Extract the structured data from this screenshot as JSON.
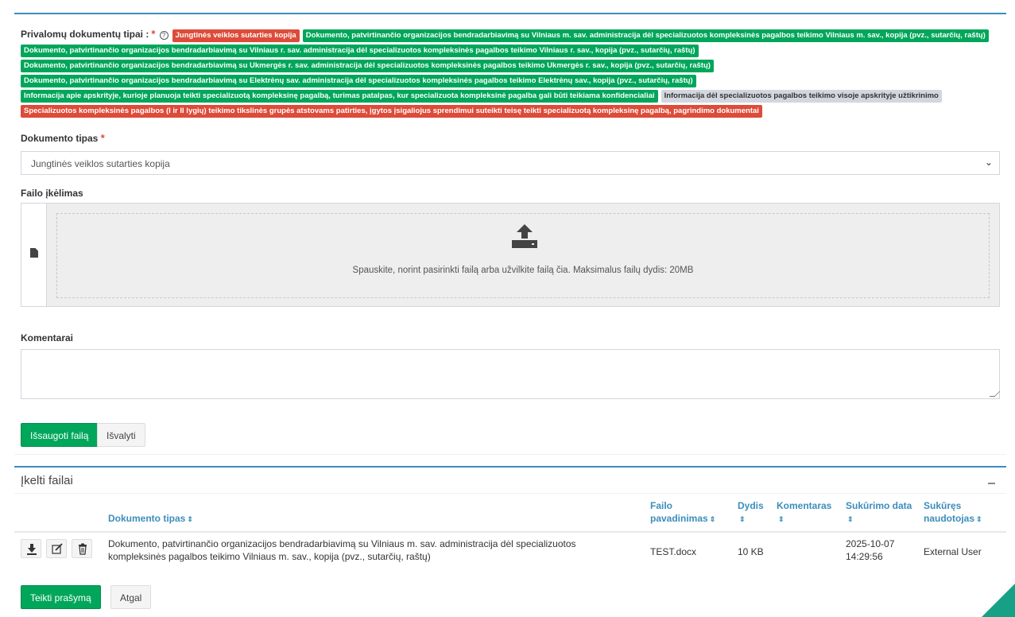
{
  "required": {
    "label": "Privalomų dokumentų tipai :",
    "star": "*",
    "help_icon": "question-circle-icon",
    "badges": [
      {
        "text": "Jungtinės veiklos sutarties kopija",
        "color": "red"
      },
      {
        "text": "Dokumento, patvirtinančio organizacijos bendradarbiavimą su Vilniaus m. sav. administracija dėl specializuotos kompleksinės pagalbos teikimo Vilniaus m. sav., kopija (pvz., sutarčių, raštų)",
        "color": "green"
      },
      {
        "text": "Dokumento, patvirtinančio organizacijos bendradarbiavimą su Vilniaus r. sav. administracija dėl specializuotos kompleksinės pagalbos teikimo Vilniaus r. sav., kopija (pvz., sutarčių, raštų)",
        "color": "green"
      },
      {
        "text": "Dokumento, patvirtinančio organizacijos bendradarbiavimą su Ukmergės r. sav. administracija dėl specializuotos kompleksinės pagalbos teikimo Ukmergės r. sav., kopija (pvz., sutarčių, raštų)",
        "color": "green"
      },
      {
        "text": "Dokumento, patvirtinančio organizacijos bendradarbiavimą su Elektrėnų sav. administracija dėl specializuotos kompleksinės pagalbos teikimo Elektrėnų sav., kopija (pvz., sutarčių, raštų)",
        "color": "green"
      },
      {
        "text": "Informacija apie apskrityje, kurioje planuoja teikti specializuotą kompleksinę pagalbą, turimas patalpas, kur specializuota kompleksinė pagalba gali būti teikiama konfidencialiai",
        "color": "green"
      },
      {
        "text": "Informacija dėl specializuotos pagalbos teikimo visoje apskrityje užtikrinimo",
        "color": "gray"
      },
      {
        "text": "Specializuotos kompleksinės pagalbos (I ir II lygių) teikimo tikslinės grupės atstovams patirties, įgytos įsigaliojus sprendimui suteikti teisę teikti specializuotą kompleksinę pagalbą, pagrindimo dokumentai",
        "color": "red"
      }
    ]
  },
  "form": {
    "doc_type_label": "Dokumento tipas",
    "doc_type_star": "*",
    "doc_type_value": "Jungtinės veiklos sutarties kopija",
    "upload_label": "Failo įkėlimas",
    "upload_hint": "Spauskite, norint pasirinkti failą arba užvilkite failą čia. Maksimalus failų dydis: 20MB",
    "comments_label": "Komentarai",
    "save_button": "Išsaugoti failą",
    "clear_button": "Išvalyti"
  },
  "files": {
    "title": "Įkelti failai",
    "columns": {
      "doc_type": "Dokumento tipas",
      "file_name_1": "Failo",
      "file_name_2": "pavadinimas",
      "size": "Dydis",
      "comment": "Komentaras",
      "created": "Sukūrimo data",
      "creator_1": "Sukūręs",
      "creator_2": "naudotojas"
    },
    "sort_icon": "⇕",
    "rows": [
      {
        "doc_type": "Dokumento, patvirtinančio organizacijos bendradarbiavimą su Vilniaus m. sav. administracija dėl specializuotos kompleksinės pagalbos teikimo Vilniaus m. sav., kopija (pvz., sutarčių, raštų)",
        "file_name": "TEST.docx",
        "size": "10 KB",
        "comment": "",
        "created_date": "2025-10-07",
        "created_time": "14:29:56",
        "creator": "External User"
      }
    ]
  },
  "footer": {
    "submit_button": "Teikti prašymą",
    "back_button": "Atgal"
  },
  "colors": {
    "primary": "#3c8dbc",
    "green": "#00a65a",
    "red": "#dd4b39",
    "gray": "#d2d6de"
  }
}
